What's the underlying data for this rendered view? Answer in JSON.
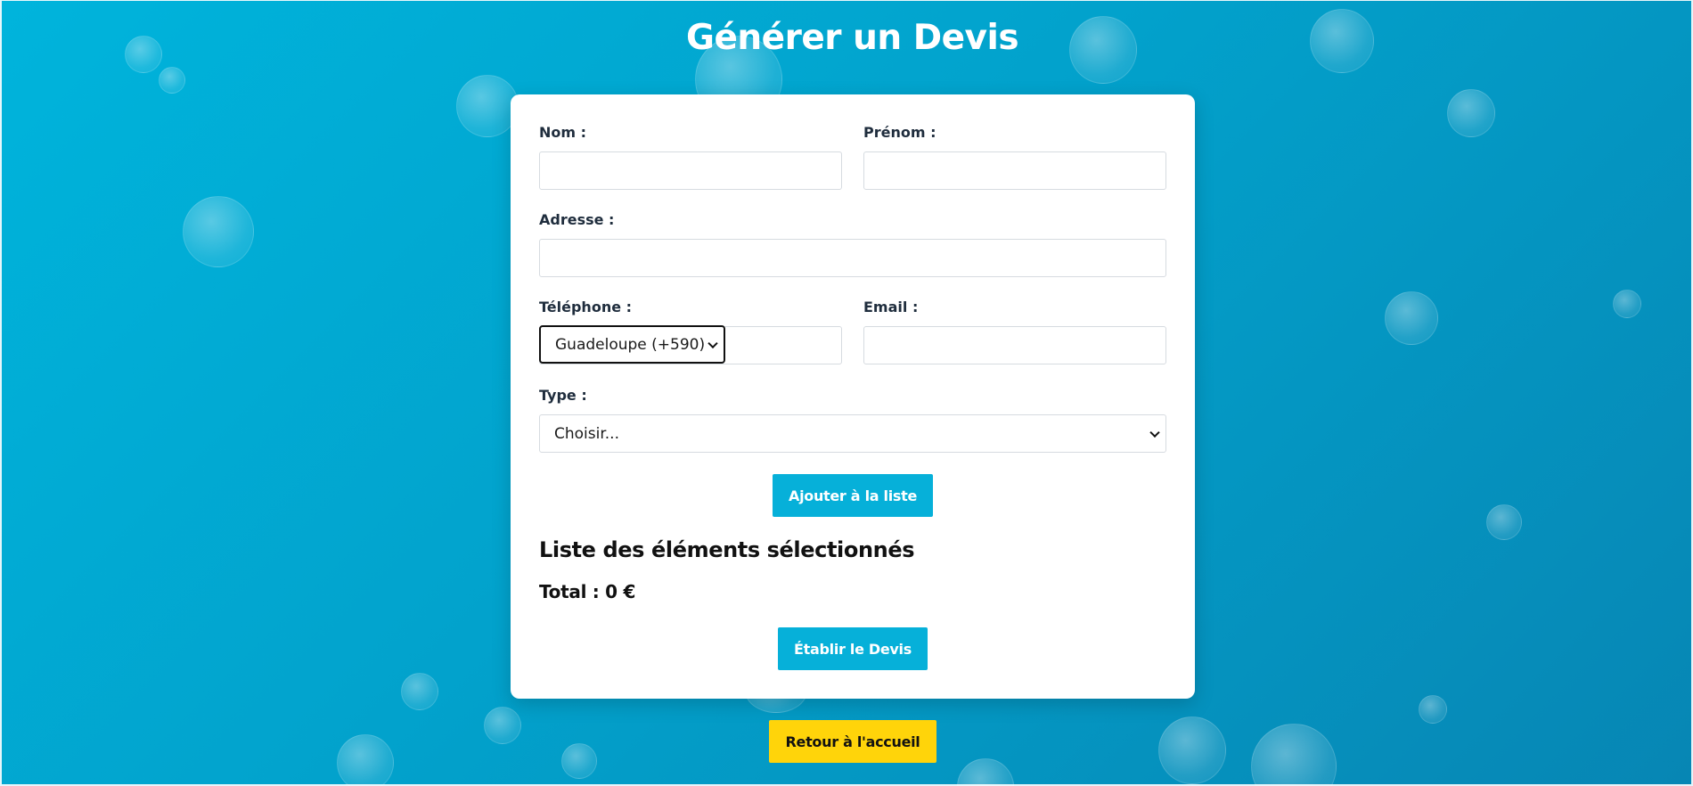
{
  "page_title": "Générer un Devis",
  "form": {
    "nom_label": "Nom :",
    "nom_value": "",
    "prenom_label": "Prénom :",
    "prenom_value": "",
    "adresse_label": "Adresse :",
    "adresse_value": "",
    "telephone_label": "Téléphone :",
    "telephone_country": "Guadeloupe (+590)",
    "telephone_value": "",
    "email_label": "Email :",
    "email_value": "",
    "type_label": "Type :",
    "type_selected": "Choisir..."
  },
  "buttons": {
    "add_to_list": "Ajouter à la liste",
    "create_quote": "Établir le Devis",
    "back_home": "Retour à l'accueil"
  },
  "list": {
    "title": "Liste des éléments sélectionnés",
    "total": "Total : 0 €"
  },
  "colors": {
    "background": "#02a2cc",
    "primary_button": "#06b0d9",
    "home_button": "#ffd40a"
  }
}
